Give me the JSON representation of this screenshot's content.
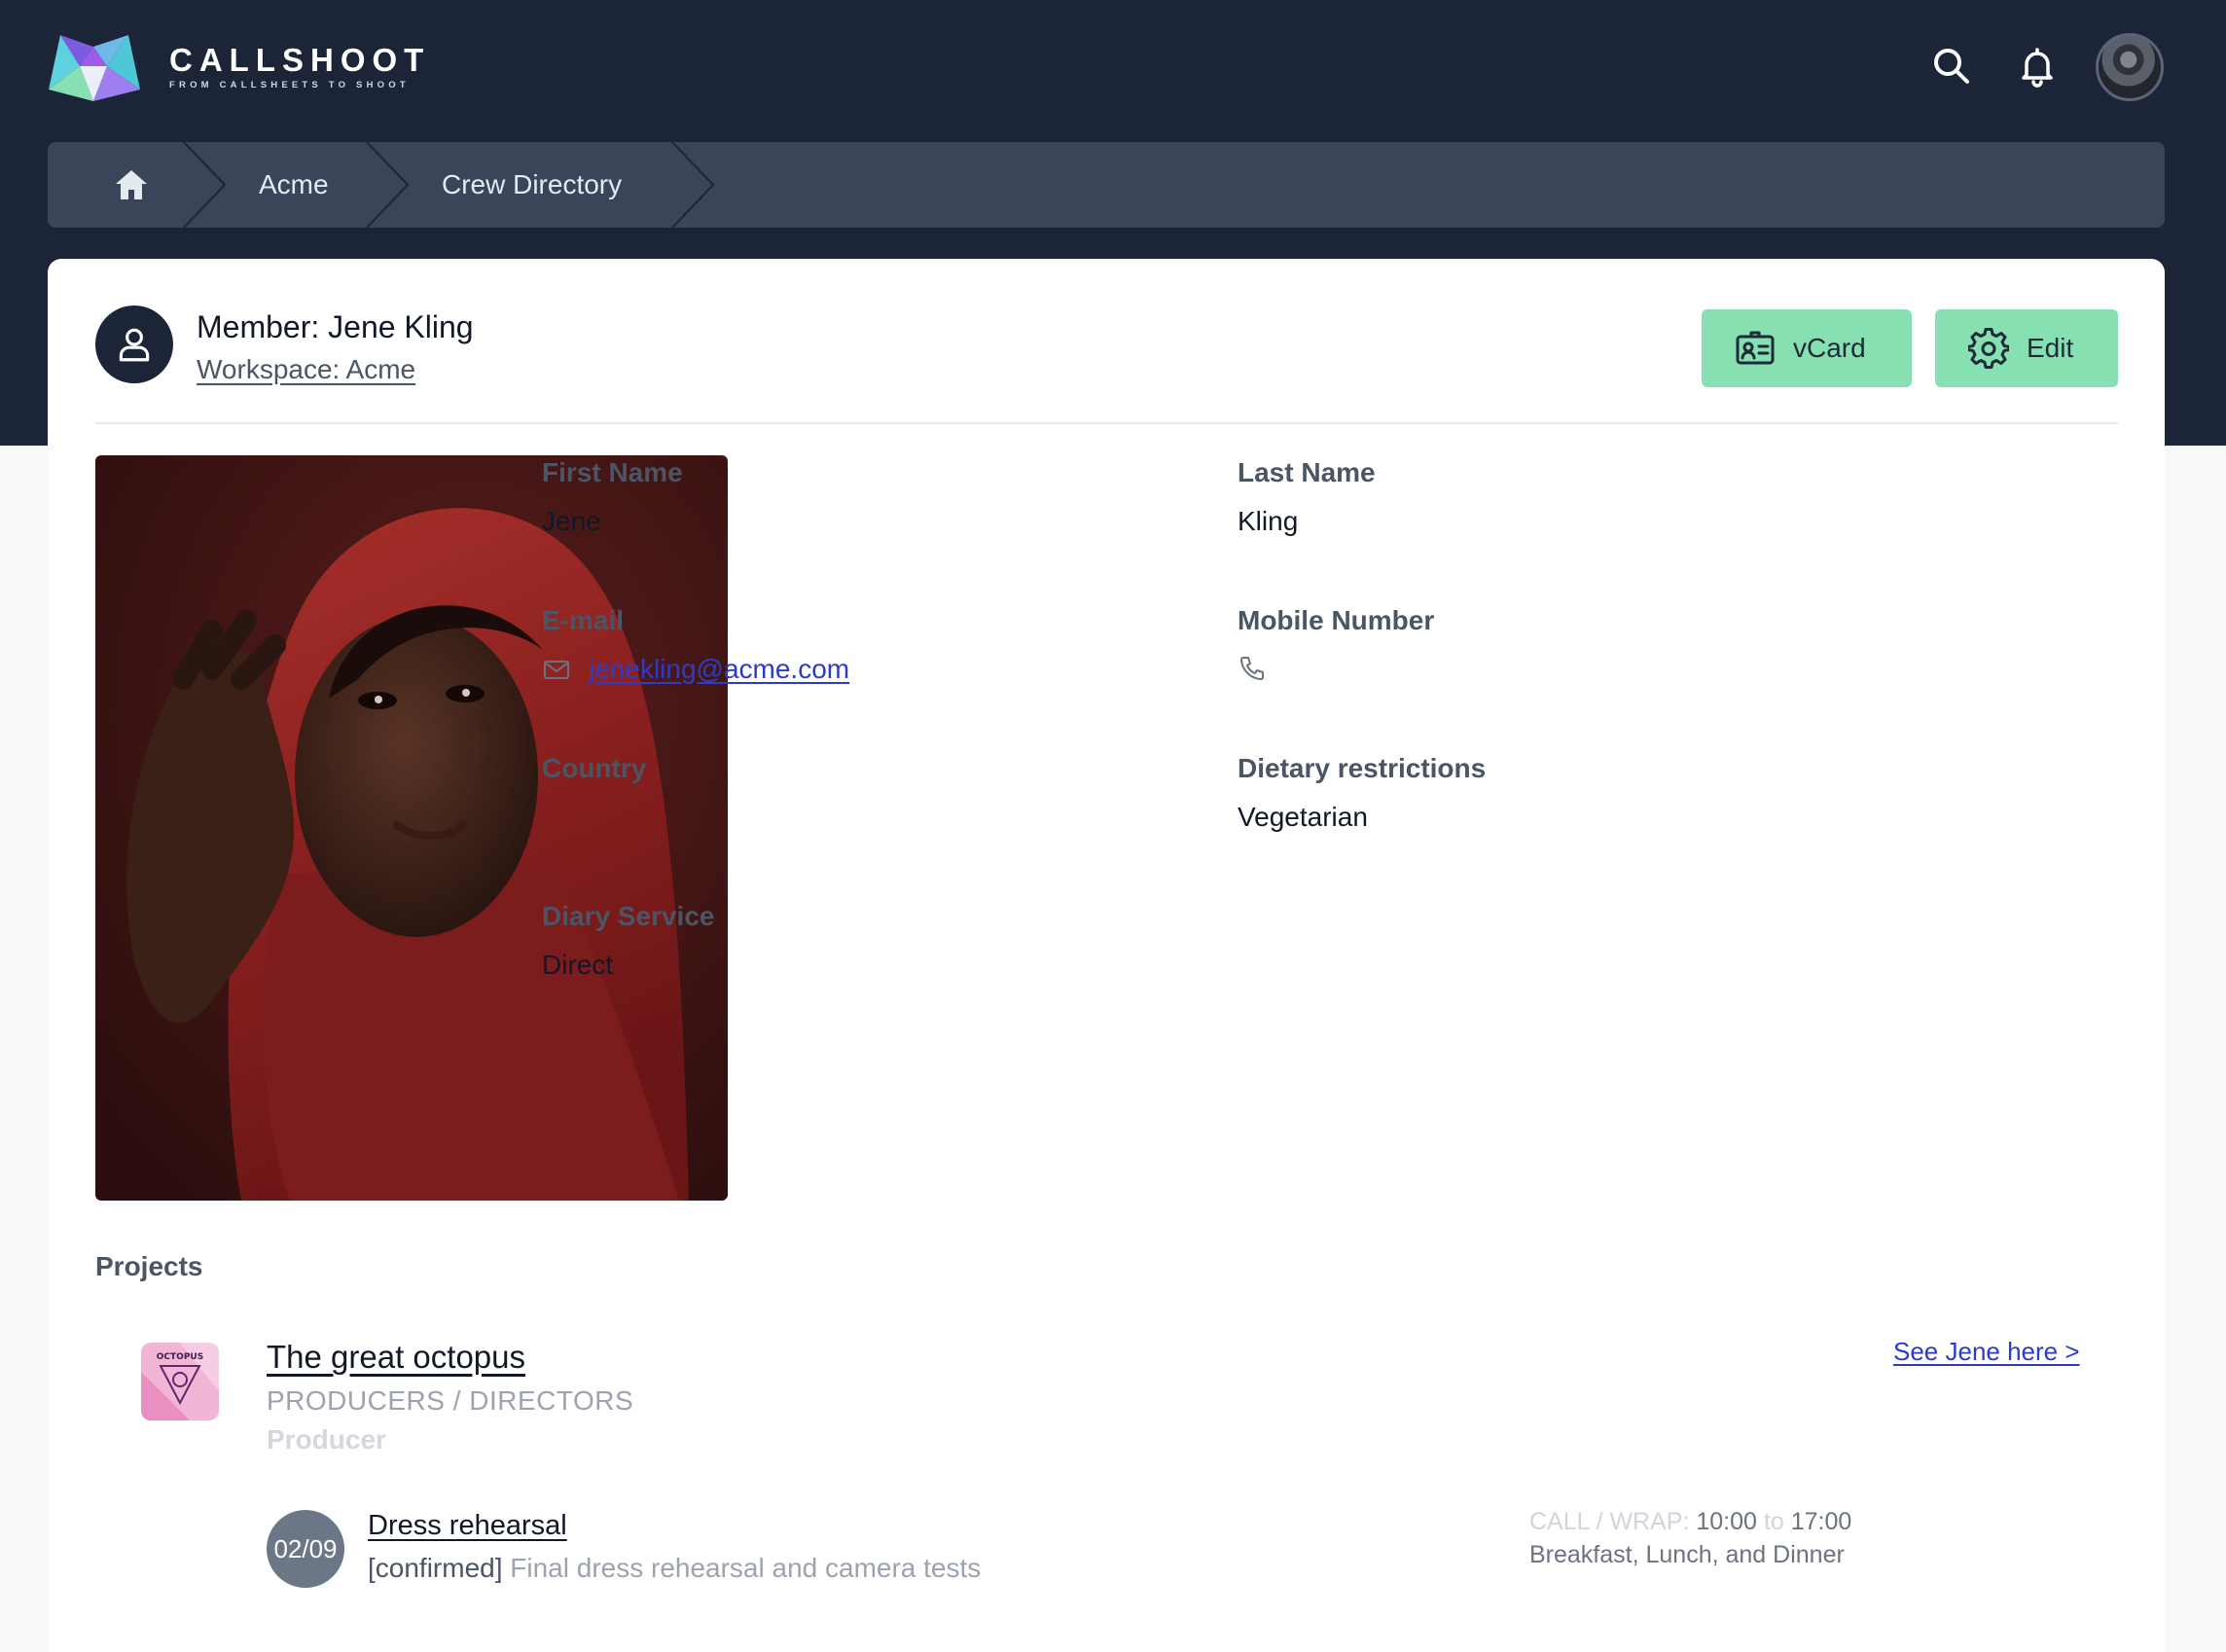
{
  "app": {
    "name": "CALLSHOOT",
    "tagline": "FROM CALLSHEETS TO SHOOT"
  },
  "header": {
    "icons": [
      "search-icon",
      "bell-icon"
    ],
    "accent": "#1c2438"
  },
  "breadcrumb": {
    "items": [
      "Acme",
      "Crew Directory"
    ]
  },
  "member": {
    "title": "Member: Jene Kling",
    "workspace": "Workspace: Acme",
    "buttons": {
      "vcard": "vCard",
      "edit": "Edit"
    },
    "button_color": "#86e0b2"
  },
  "fields": {
    "first_name": {
      "label": "First Name",
      "value": "Jene"
    },
    "last_name": {
      "label": "Last Name",
      "value": "Kling"
    },
    "email": {
      "label": "E-mail",
      "value": "jenekling@acme.com"
    },
    "mobile": {
      "label": "Mobile Number",
      "value": ""
    },
    "country": {
      "label": "Country",
      "value": ""
    },
    "dietary": {
      "label": "Dietary restrictions",
      "value": "Vegetarian"
    },
    "diary": {
      "label": "Diary Service",
      "value": "Direct"
    }
  },
  "projects": {
    "label": "Projects",
    "items": [
      {
        "name": "The great octopus",
        "logo_text": "OCTOPUS",
        "department": "PRODUCERS / DIRECTORS",
        "role": "Producer",
        "see_link": "See Jene here >",
        "events": [
          {
            "date": "02/09",
            "title": "Dress rehearsal",
            "status": "[confirmed]",
            "description": "Final dress rehearsal and camera tests",
            "call_wrap_label": "CALL / WRAP:",
            "call": "10:00",
            "to": "to",
            "wrap": "17:00",
            "meals": "Breakfast, Lunch, and Dinner"
          }
        ]
      }
    ]
  }
}
